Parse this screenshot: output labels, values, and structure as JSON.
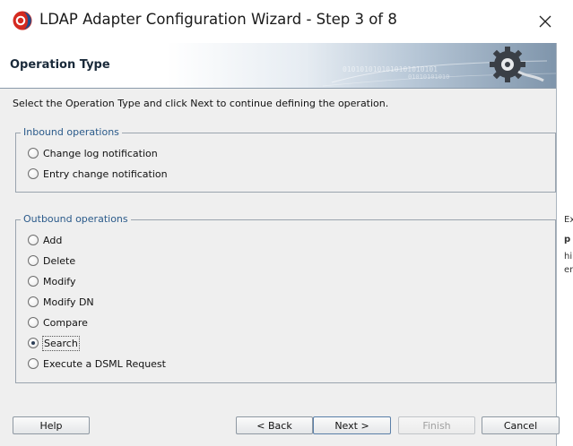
{
  "window": {
    "title": "LDAP Adapter Configuration Wizard - Step 3 of 8",
    "close_icon": "close-icon"
  },
  "header": {
    "title": "Operation Type",
    "decoration_text": "010101010101010101010101"
  },
  "main": {
    "instruction": "Select the Operation Type and click Next to continue defining the operation.",
    "inbound": {
      "legend": "Inbound operations",
      "options": [
        {
          "label": "Change log notification",
          "checked": false
        },
        {
          "label": "Entry change notification",
          "checked": false
        }
      ]
    },
    "outbound": {
      "legend": "Outbound operations",
      "options": [
        {
          "label": "Add",
          "checked": false
        },
        {
          "label": "Delete",
          "checked": false
        },
        {
          "label": "Modify",
          "checked": false
        },
        {
          "label": "Modify DN",
          "checked": false
        },
        {
          "label": "Compare",
          "checked": false
        },
        {
          "label": "Search",
          "checked": true
        },
        {
          "label": "Execute a DSML Request",
          "checked": false
        }
      ]
    }
  },
  "buttons": {
    "help": "Help",
    "back": "< Back",
    "next": "Next >",
    "finish": "Finish",
    "cancel": "Cancel"
  },
  "background_window": {
    "fragments": [
      "Ext",
      "p",
      "hi",
      "en"
    ]
  }
}
